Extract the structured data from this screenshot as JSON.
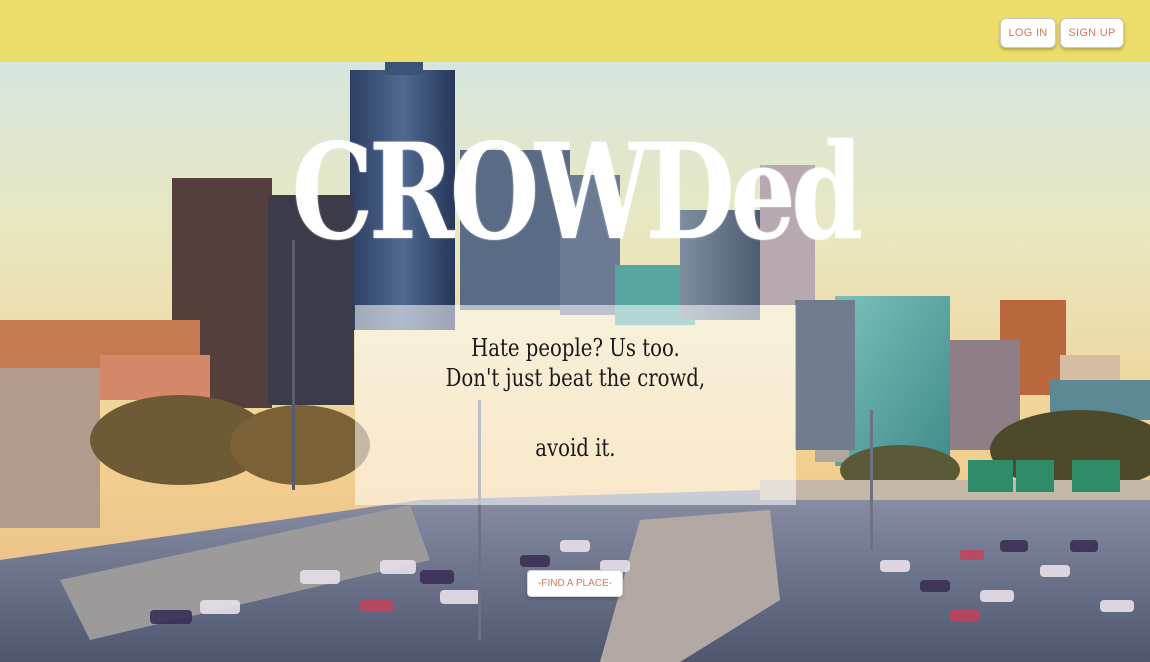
{
  "nav": {
    "login_label": "LOG IN",
    "signup_label": "SIGN UP"
  },
  "hero": {
    "title": "CROWDed",
    "tagline_line1": "Hate people? Us too.",
    "tagline_line2": "Don't just beat the crowd,",
    "tagline_line3": "avoid it.",
    "cta_label": "-FIND A PLACE-"
  },
  "colors": {
    "topbar": "#ecdc6a",
    "button_text": "#d07a58",
    "title": "#ffffff"
  }
}
